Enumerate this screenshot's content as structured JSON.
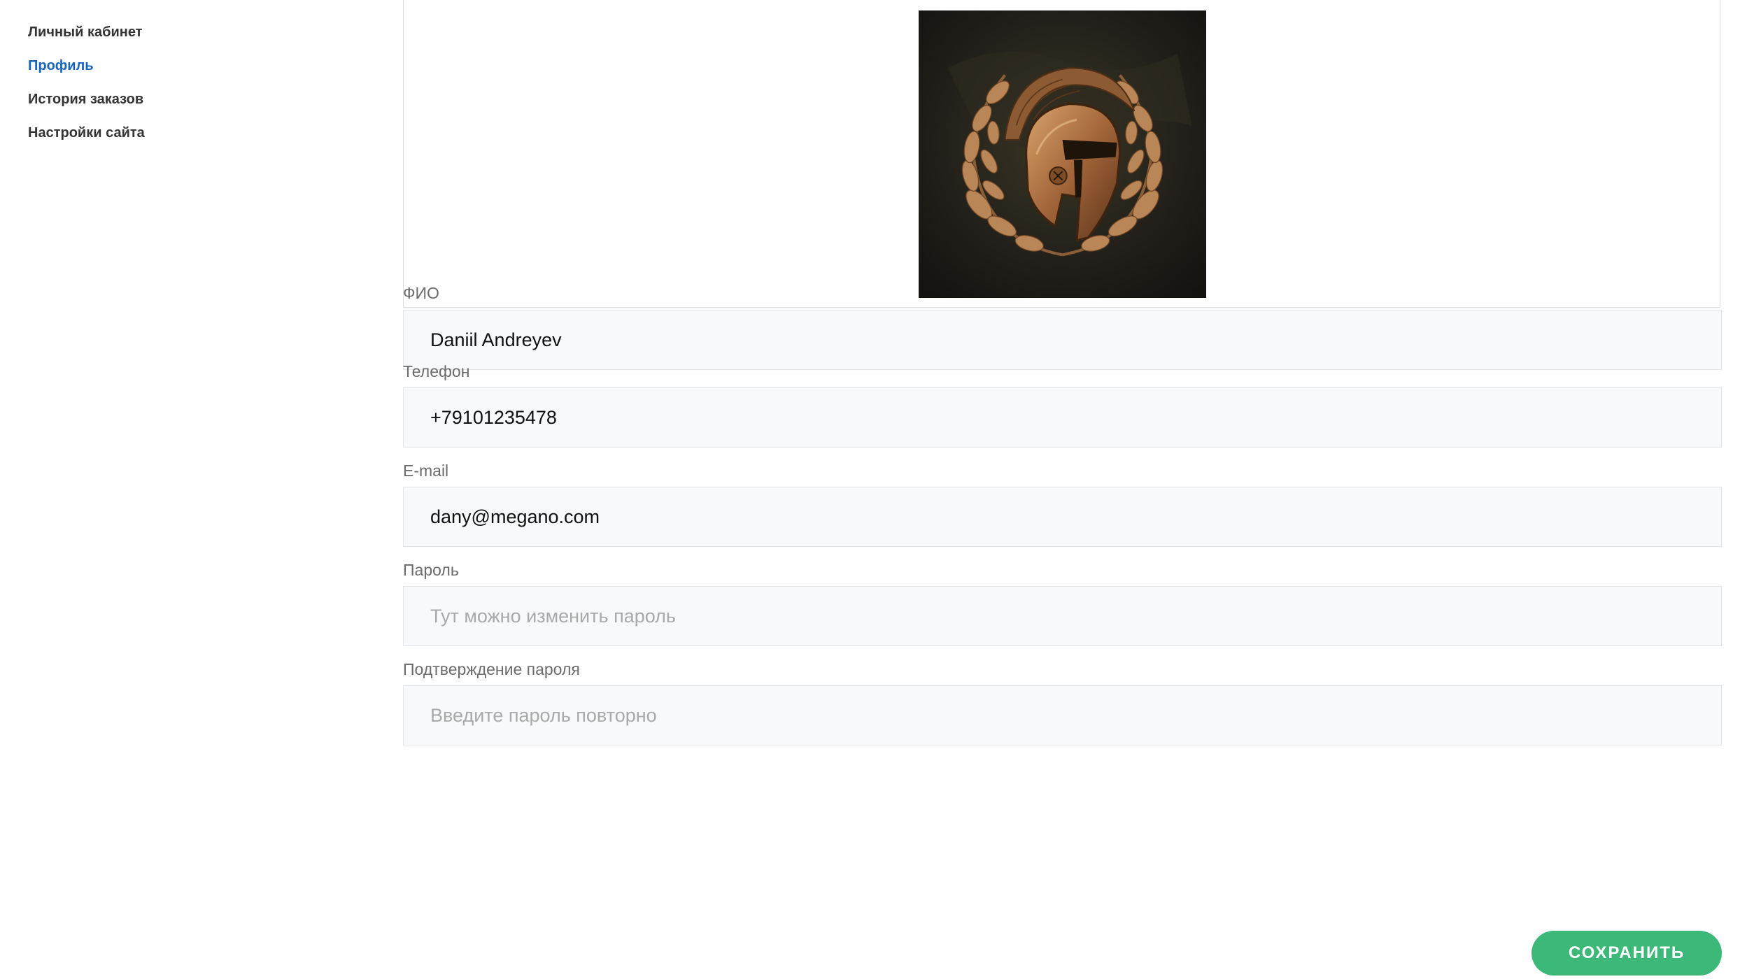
{
  "sidebar": {
    "items": [
      {
        "label": "Личный кабинет",
        "active": false
      },
      {
        "label": "Профиль",
        "active": true
      },
      {
        "label": "История заказов",
        "active": false
      },
      {
        "label": "Настройки сайта",
        "active": false
      }
    ]
  },
  "profile": {
    "avatar_icon": "spartan-helmet-laurel-wreath-image",
    "fields": {
      "name": {
        "label": "ФИО",
        "value": "Daniil Andreyev",
        "placeholder": ""
      },
      "phone": {
        "label": "Телефон",
        "value": "+79101235478",
        "placeholder": ""
      },
      "email": {
        "label": "E-mail",
        "value": "dany@megano.com",
        "placeholder": ""
      },
      "password": {
        "label": "Пароль",
        "value": "",
        "placeholder": "Тут можно изменить пароль"
      },
      "password_confirm": {
        "label": "Подтверждение пароля",
        "value": "",
        "placeholder": "Введите пароль повторно"
      }
    },
    "save_label": "СОХРАНИТЬ"
  },
  "colors": {
    "active_link": "#1565c0",
    "save_button": "#3cb878",
    "input_background": "#f8f9fa",
    "input_border": "#e3e5e8"
  }
}
